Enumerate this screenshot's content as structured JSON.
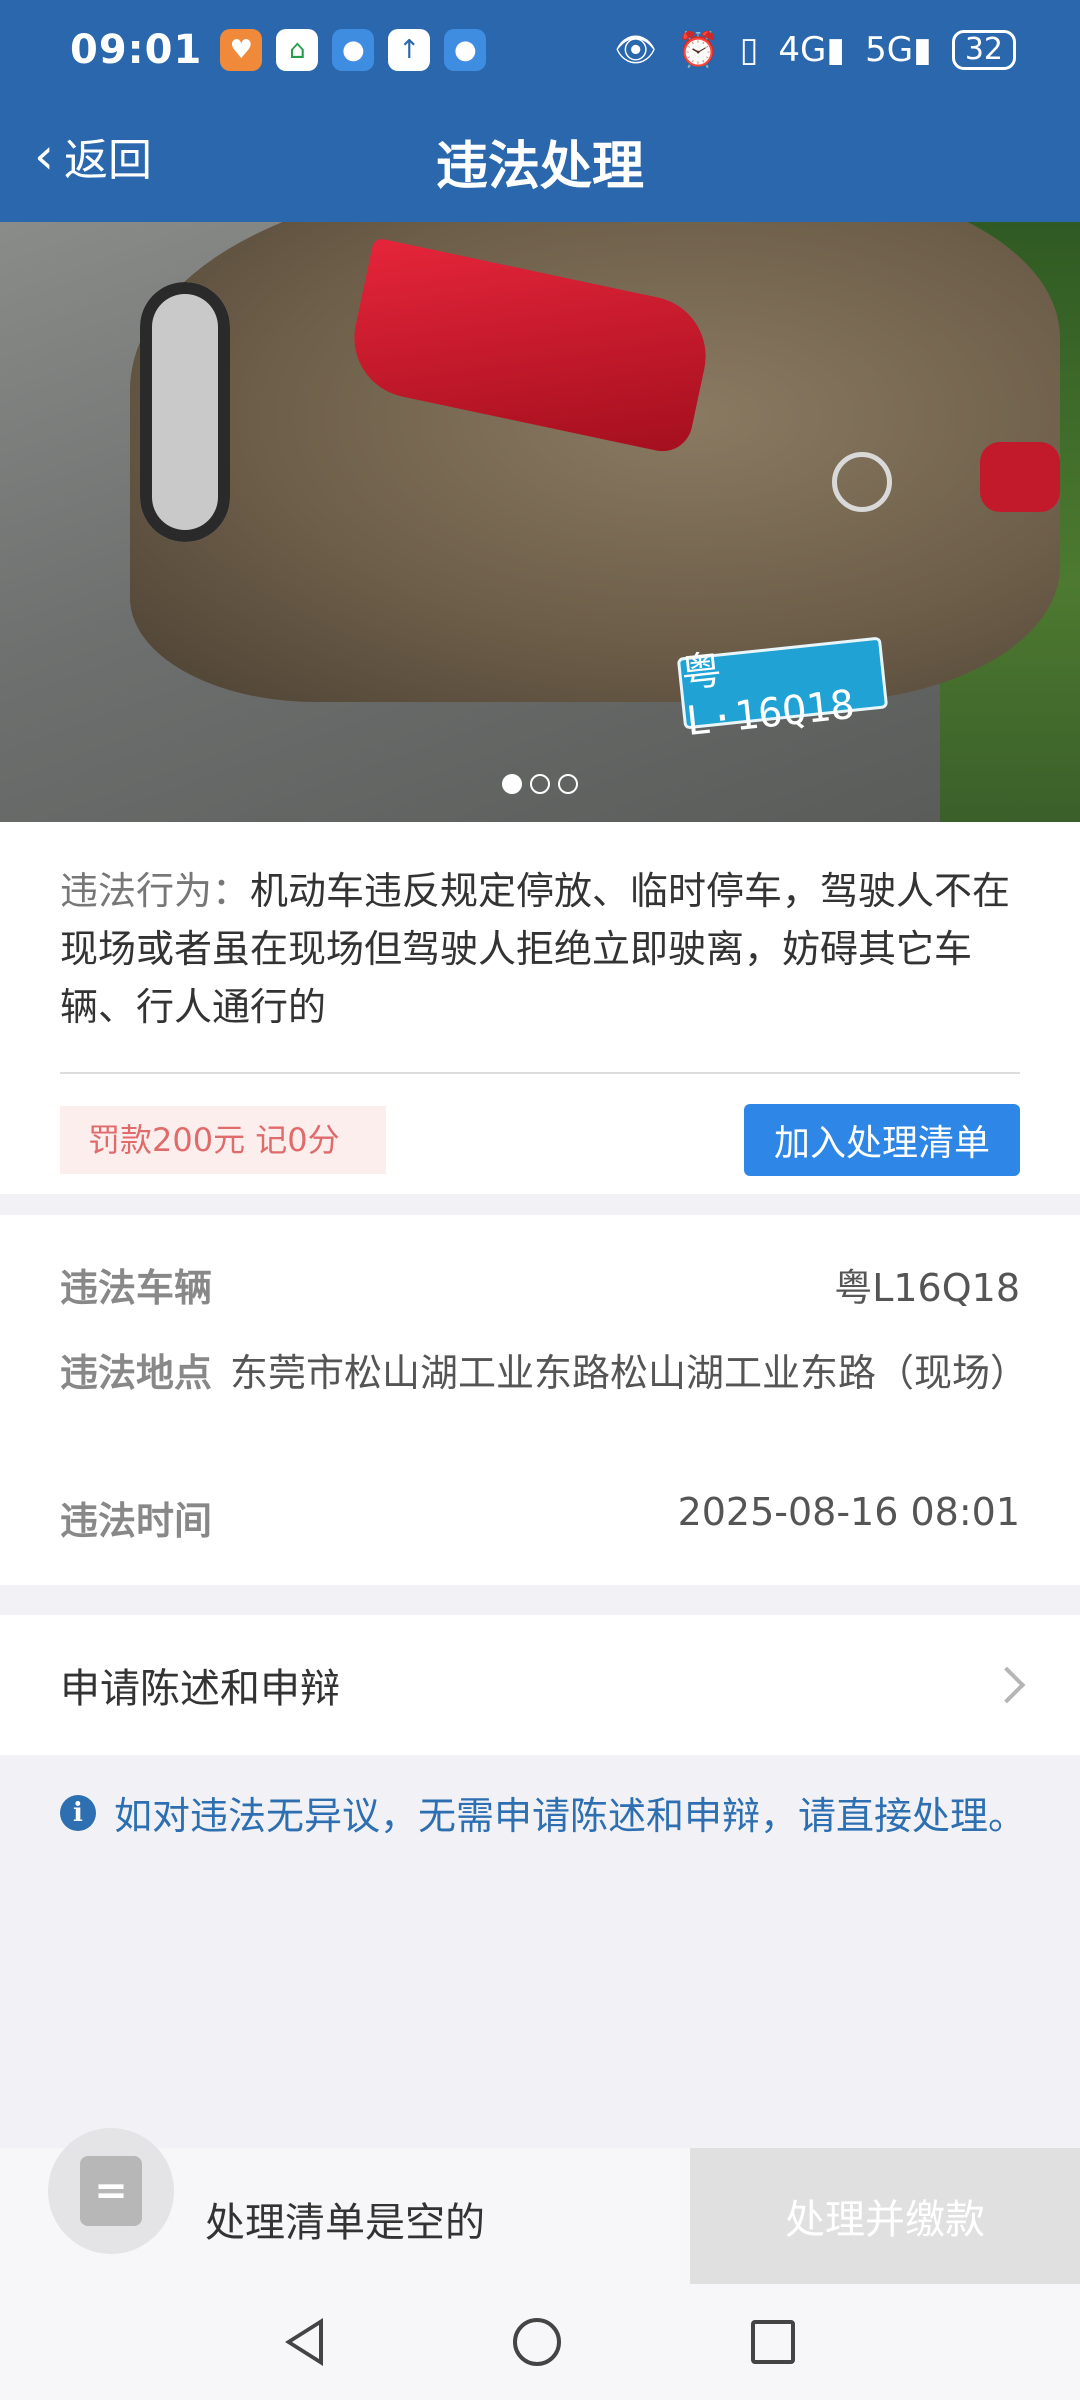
{
  "status_bar": {
    "time": "09:01",
    "network_4g": "4G",
    "network_5g": "5G",
    "battery": "32"
  },
  "header": {
    "back_label": "返回",
    "title": "违法处理"
  },
  "photo": {
    "plate_text": "粤L·16Q18",
    "page_count": 3,
    "current_page": 1
  },
  "violation": {
    "behavior_label": "违法行为：",
    "behavior_text": "机动车违反规定停放、临时停车，驾驶人不在现场或者虽在现场但驾驶人拒绝立即驶离，妨碍其它车辆、行人通行的",
    "penalty": "罚款200元 记0分",
    "add_button": "加入处理清单"
  },
  "details": {
    "vehicle_label": "违法车辆",
    "vehicle_value": "粤L16Q18",
    "location_label": "违法地点",
    "location_value": "东莞市松山湖工业东路松山湖工业东路（现场）",
    "time_label": "违法时间",
    "time_value": "2025-08-16 08:01"
  },
  "appeal": {
    "label": "申请陈述和申辩"
  },
  "notice": {
    "text": "如对违法无异议，无需申请陈述和申辩，请直接处理。"
  },
  "bottom_bar": {
    "empty_text": "处理清单是空的",
    "pay_button": "处理并缴款"
  },
  "colors": {
    "header_bg": "#2a67ad",
    "primary_button": "#2e86e6",
    "penalty_text": "#e06b6b",
    "notice_text": "#2d6fb0"
  }
}
